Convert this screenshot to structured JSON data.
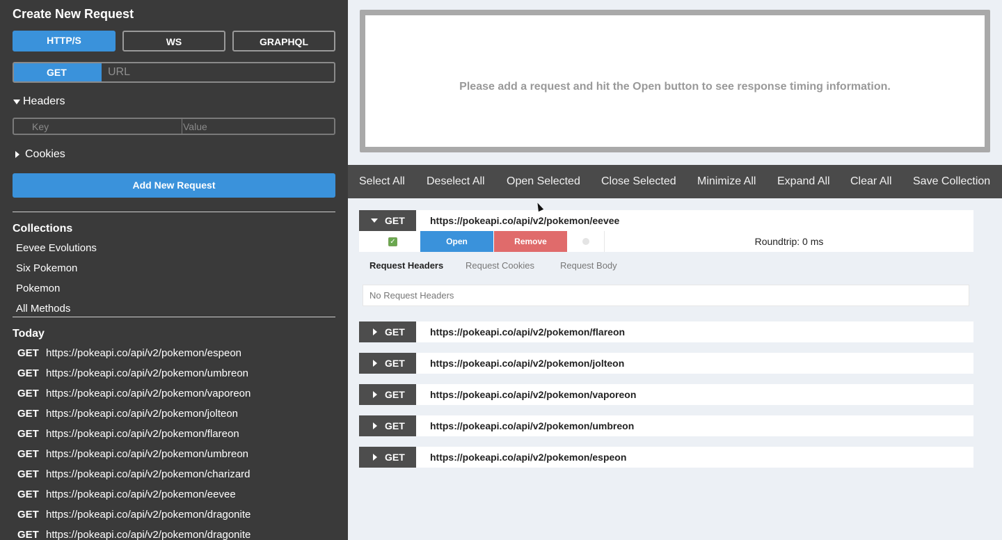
{
  "sidebar": {
    "title": "Create New Request",
    "protocols": [
      "HTTP/S",
      "WS",
      "GRAPHQL"
    ],
    "active_protocol": "HTTP/S",
    "method": "GET",
    "url_placeholder": "URL",
    "headers_label": "Headers",
    "key_placeholder": "Key",
    "value_placeholder": "Value",
    "cookies_label": "Cookies",
    "add_button": "Add New Request",
    "collections_heading": "Collections",
    "collections": [
      "Eevee Evolutions",
      "Six Pokemon",
      "Pokemon",
      "All Methods"
    ],
    "today_heading": "Today",
    "history": [
      {
        "method": "GET",
        "url": "https://pokeapi.co/api/v2/pokemon/espeon"
      },
      {
        "method": "GET",
        "url": "https://pokeapi.co/api/v2/pokemon/umbreon"
      },
      {
        "method": "GET",
        "url": "https://pokeapi.co/api/v2/pokemon/vaporeon"
      },
      {
        "method": "GET",
        "url": "https://pokeapi.co/api/v2/pokemon/jolteon"
      },
      {
        "method": "GET",
        "url": "https://pokeapi.co/api/v2/pokemon/flareon"
      },
      {
        "method": "GET",
        "url": "https://pokeapi.co/api/v2/pokemon/umbreon"
      },
      {
        "method": "GET",
        "url": "https://pokeapi.co/api/v2/pokemon/charizard"
      },
      {
        "method": "GET",
        "url": "https://pokeapi.co/api/v2/pokemon/eevee"
      },
      {
        "method": "GET",
        "url": "https://pokeapi.co/api/v2/pokemon/dragonite"
      },
      {
        "method": "GET",
        "url": "https://pokeapi.co/api/v2/pokemon/dragonite"
      }
    ]
  },
  "timing": {
    "message": "Please add a request and hit the Open button to see response timing information."
  },
  "toolbar": {
    "buttons": [
      "Select All",
      "Deselect All",
      "Open Selected",
      "Close Selected",
      "Minimize All",
      "Expand All",
      "Clear All",
      "Save Collection"
    ]
  },
  "requests": [
    {
      "method": "GET",
      "url": "https://pokeapi.co/api/v2/pokemon/eevee",
      "expanded": true
    },
    {
      "method": "GET",
      "url": "https://pokeapi.co/api/v2/pokemon/flareon",
      "expanded": false
    },
    {
      "method": "GET",
      "url": "https://pokeapi.co/api/v2/pokemon/jolteon",
      "expanded": false
    },
    {
      "method": "GET",
      "url": "https://pokeapi.co/api/v2/pokemon/vaporeon",
      "expanded": false
    },
    {
      "method": "GET",
      "url": "https://pokeapi.co/api/v2/pokemon/umbreon",
      "expanded": false
    },
    {
      "method": "GET",
      "url": "https://pokeapi.co/api/v2/pokemon/espeon",
      "expanded": false
    }
  ],
  "expanded_request": {
    "open_label": "Open",
    "remove_label": "Remove",
    "roundtrip": "Roundtrip: 0 ms",
    "tabs": [
      "Request Headers",
      "Request Cookies",
      "Request Body"
    ],
    "active_tab": "Request Headers",
    "no_headers": "No Request Headers"
  },
  "colors": {
    "accent": "#3a92db",
    "danger": "#e06b6b",
    "sidebar_bg": "#3a3a3a",
    "toolbar_bg": "#4a4a4a"
  }
}
